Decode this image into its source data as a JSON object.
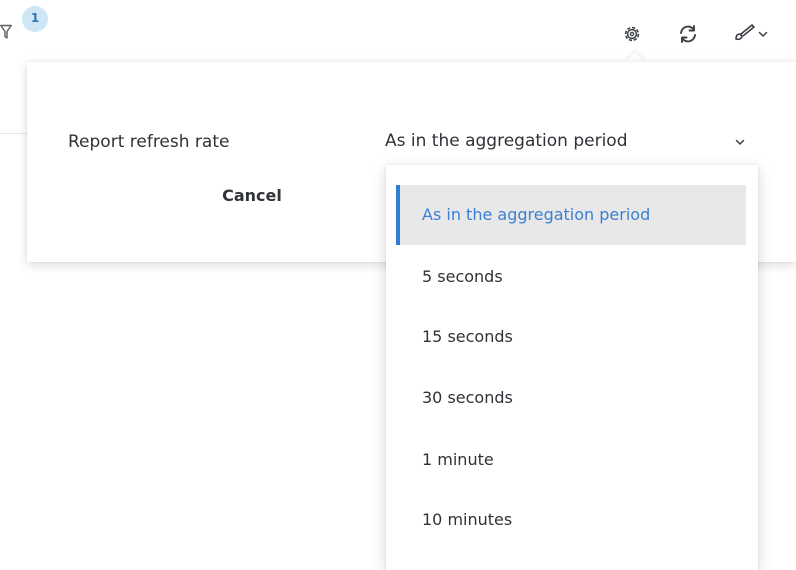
{
  "toolbar": {
    "filter_badge_count": "1",
    "icons": [
      "filter-icon",
      "gear-icon",
      "refresh-icon",
      "brush-icon",
      "chevron-down-icon"
    ]
  },
  "settings": {
    "refresh_label": "Report refresh rate",
    "selected_rate": "As in the aggregation period",
    "cancel_label": "Cancel"
  },
  "dropdown": {
    "options": [
      "As in the aggregation period",
      "5 seconds",
      "15 seconds",
      "30 seconds",
      "1 minute",
      "10 minutes"
    ],
    "selected_index": 0
  },
  "colors": {
    "accent": "#2e7dd2",
    "selected_text": "#3c7fd4",
    "selected_bg": "#e8e8e8",
    "badge_bg": "#cfe6f7",
    "text": "#2f3337"
  }
}
